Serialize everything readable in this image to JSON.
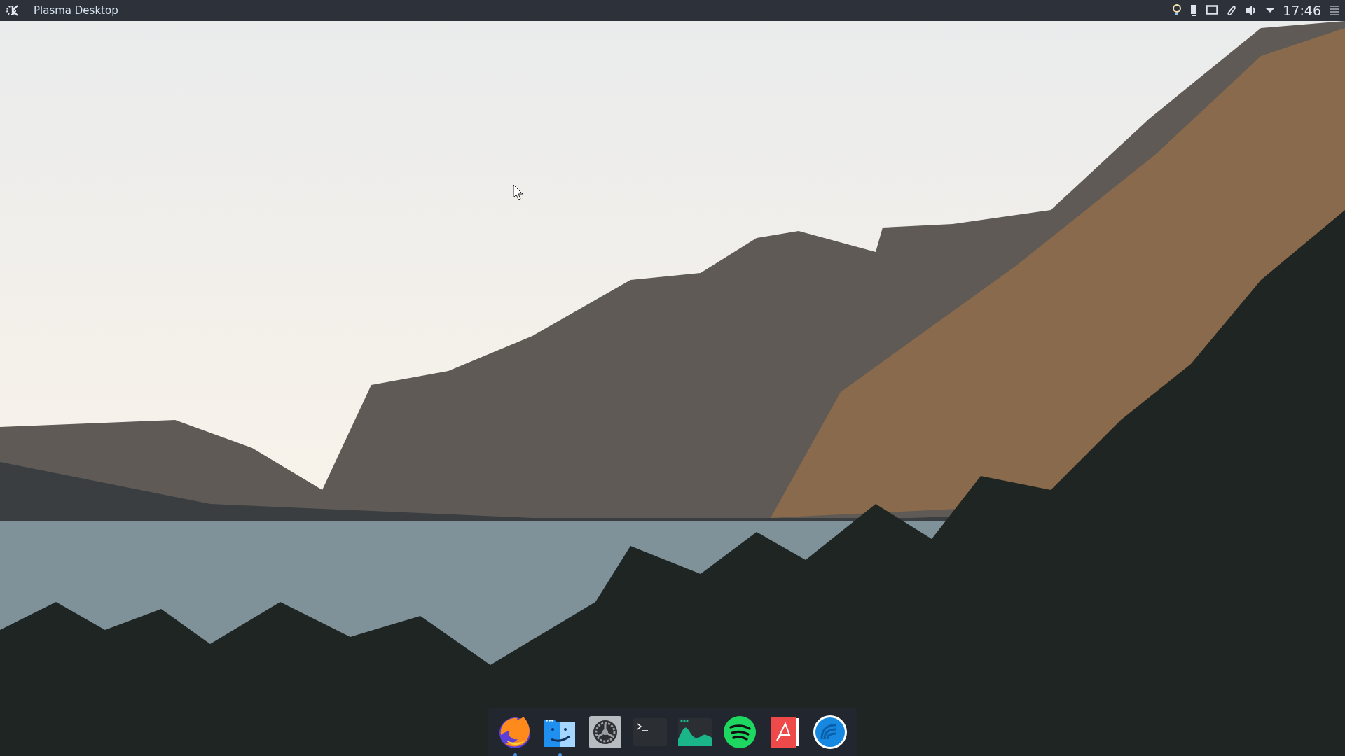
{
  "top_bar": {
    "app_title": "Plasma Desktop",
    "clock": "17:46"
  },
  "dock": {
    "items": [
      {
        "kind": "browser",
        "running": true
      },
      {
        "kind": "files",
        "running": true
      },
      {
        "kind": "settings",
        "running": false
      },
      {
        "kind": "terminal",
        "running": false
      },
      {
        "kind": "monitor",
        "running": false
      },
      {
        "kind": "music",
        "running": false
      },
      {
        "kind": "pdf",
        "running": false
      },
      {
        "kind": "torrent",
        "running": false
      }
    ]
  }
}
